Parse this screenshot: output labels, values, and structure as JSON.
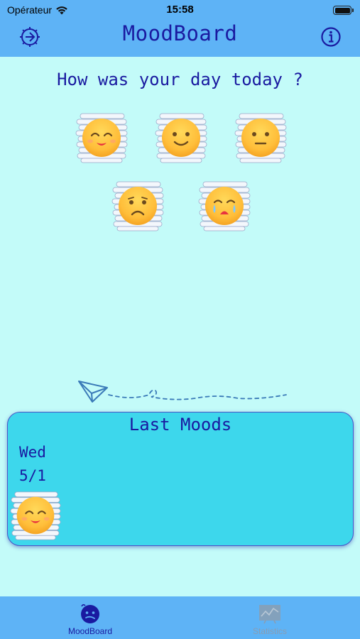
{
  "status_bar": {
    "carrier": "Opérateur",
    "time": "15:58"
  },
  "header": {
    "title": "MoodBoard"
  },
  "prompt": {
    "question": "How was your day today ?"
  },
  "moods": [
    {
      "icon": "smiling-face-icon",
      "mouth": "grin"
    },
    {
      "icon": "happy-face-icon",
      "mouth": "smile"
    },
    {
      "icon": "neutral-face-icon",
      "mouth": "flat"
    },
    {
      "icon": "sad-face-icon",
      "mouth": "frown"
    },
    {
      "icon": "crying-face-icon",
      "mouth": "cry"
    }
  ],
  "last_moods": {
    "title": "Last Moods",
    "entries": [
      {
        "day": "Wed",
        "date": "5/1",
        "icon": "smiling-face-icon"
      }
    ]
  },
  "tabbar": {
    "tabs": [
      {
        "label": "MoodBoard",
        "icon": "moodboard-tab-icon",
        "active": true
      },
      {
        "label": "Statistics",
        "icon": "statistics-chart-icon",
        "active": false
      }
    ]
  },
  "colors": {
    "background": "#c3fbf9",
    "header": "#5eb3f6",
    "accent_text": "#1a1aa0",
    "panel": "#3dd7ec",
    "emoji_yellow": "#ffc93c"
  }
}
